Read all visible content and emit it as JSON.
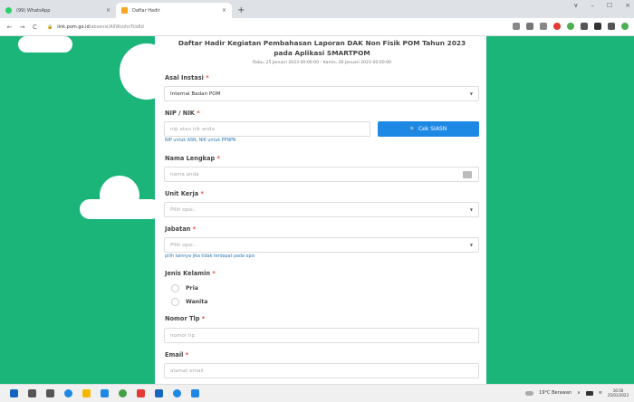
{
  "browser": {
    "tabs": [
      {
        "title": "(99) WhatsApp",
        "close": "×",
        "color": "#25d366"
      },
      {
        "title": "Daftar Hadir",
        "close": "×",
        "color": "#f5a623"
      }
    ],
    "new_tab": "+",
    "window_controls": [
      "∨",
      "–",
      "☐",
      "×"
    ],
    "nav": {
      "back": "←",
      "forward": "→",
      "reload": "C"
    },
    "url_host": "link.pom.go.id",
    "url_path": "/absensi/AllWsohnTcb8d",
    "ext_colors": [
      "#888",
      "#777",
      "#888",
      "#e53935",
      "#4caf50",
      "#555",
      "#333",
      "#555",
      "#4caf50"
    ]
  },
  "form": {
    "title": "Daftar Hadir Kegiatan Pembahasan Laporan DAK Non Fisik POM Tahun 2023 pada Aplikasi SMARTPOM",
    "subtitle": "Rabu, 25 Januari 2023 00:00:00 - Kamis, 26 Januari 2023 00:00:00",
    "req": "*",
    "asal_label": "Asal Instasi",
    "asal_value": "Internal Badan POM",
    "nip_label": "NIP / NIK",
    "nip_placeholder": "nip atau nik anda",
    "nip_hint": "NIP untuk ASN, NIK untuk PPNPN",
    "cek_button": "Cek SIASN",
    "search_icon": "🔍",
    "nama_label": "Nama Lengkap",
    "nama_placeholder": "nama anda",
    "unit_label": "Unit Kerja",
    "unit_value": "Pilih opsi..",
    "jabatan_label": "Jabatan",
    "jabatan_value": "Pilih opsi..",
    "jabatan_hint": "pilih lainnya jika tidak terdapat pada opsi",
    "jk_label": "Jenis Kelamin",
    "jk_options": [
      "Pria",
      "Wanita"
    ],
    "tlp_label": "Nomor Tlp",
    "tlp_placeholder": "nomor hp",
    "email_label": "Email",
    "email_placeholder": "alamat email",
    "caret": "▼"
  },
  "taskbar": {
    "icon_colors": [
      "#1565c0",
      "#555",
      "#555",
      "#1e88e5",
      "#f5b800",
      "#1e88e5",
      "#43a047",
      "#e53935",
      "#1565c0",
      "#1e88e5",
      "#1e88e5"
    ],
    "weather": "19°C Berawan",
    "time": "16:56",
    "date": "25/01/2023"
  }
}
